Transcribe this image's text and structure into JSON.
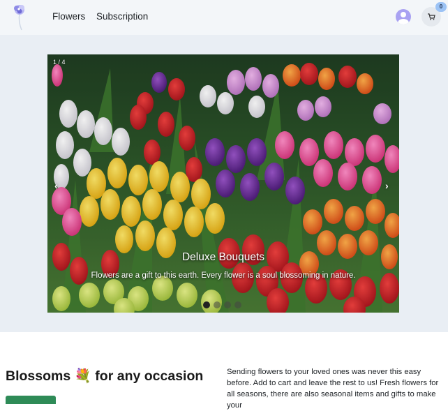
{
  "nav": {
    "links": [
      {
        "label": "Flowers"
      },
      {
        "label": "Subscription"
      }
    ],
    "cart_count": "0",
    "icons": {
      "logo": "flower-logo",
      "user": "user-avatar-icon",
      "cart": "cart-icon"
    }
  },
  "carousel": {
    "counter": "1 / 4",
    "prev_glyph": "‹",
    "next_glyph": "›",
    "title": "Deluxe Bouquets",
    "text": "Flowers are a gift to this earth. Every flower is a soul blossoming in nature.",
    "slide_count": 4,
    "active_index": 0
  },
  "section": {
    "headline": "Blossoms 💐 for any occasion",
    "body": "Sending flowers to your loved ones was never this easy before. Add to cart and leave the rest to us! Fresh flowers for all seasons, there are also seasonal items and gifts to make your"
  },
  "colors": {
    "navbar_bg": "#f3f6f9",
    "hero_bg": "#e9eef4",
    "accent_green": "#2e8b57",
    "avatar": "#a9a2f2",
    "badge": "#9cc3f5"
  }
}
